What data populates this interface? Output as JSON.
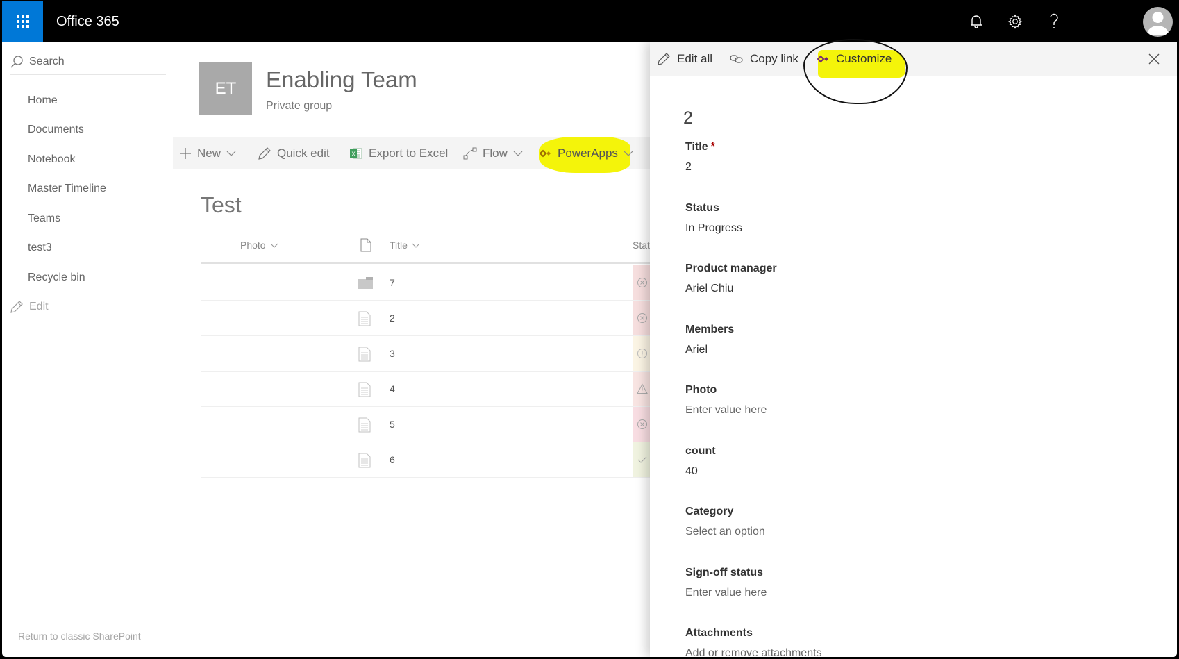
{
  "suitebar": {
    "brand": "Office 365",
    "icons": [
      "waffle-icon",
      "bell-icon",
      "gear-icon",
      "help-icon",
      "avatar-icon"
    ],
    "accent": "#0078d7"
  },
  "leftnav": {
    "search_placeholder": "Search",
    "items": [
      {
        "label": "Home"
      },
      {
        "label": "Documents"
      },
      {
        "label": "Notebook"
      },
      {
        "label": "Master Timeline"
      },
      {
        "label": "Teams"
      },
      {
        "label": "test3"
      },
      {
        "label": "Recycle bin"
      }
    ],
    "edit_label": "Edit",
    "classic_link": "Return to classic SharePoint"
  },
  "site": {
    "logo_initials": "ET",
    "title": "Enabling Team",
    "subtitle": "Private group"
  },
  "commandbar": {
    "new": "New",
    "quick_edit": "Quick edit",
    "export": "Export to Excel",
    "flow": "Flow",
    "powerapps": "PowerApps"
  },
  "list": {
    "title": "Test",
    "columns": {
      "photo": "Photo",
      "title": "Title",
      "status": "Stat"
    },
    "rows": [
      {
        "type": "folder",
        "title": "7",
        "status": "blocked",
        "status_color": "#f6dede"
      },
      {
        "type": "item",
        "title": "2",
        "status": "blocked",
        "status_color": "#f6dede"
      },
      {
        "type": "item",
        "title": "3",
        "status": "info",
        "status_color": "#fbf4e4"
      },
      {
        "type": "item",
        "title": "4",
        "status": "warning",
        "status_color": "#f8e4e2"
      },
      {
        "type": "item",
        "title": "5",
        "status": "blocked",
        "status_color": "#f8dde2"
      },
      {
        "type": "item",
        "title": "6",
        "status": "done",
        "status_color": "#f0f3e0"
      }
    ]
  },
  "panel": {
    "edit_all": "Edit all",
    "copy_link": "Copy link",
    "customize": "Customize",
    "item_header": "2",
    "fields": [
      {
        "label": "Title",
        "required": true,
        "value": "2",
        "placeholder": false
      },
      {
        "label": "Status",
        "required": false,
        "value": "In Progress",
        "placeholder": false
      },
      {
        "label": "Product manager",
        "required": false,
        "value": "Ariel Chiu",
        "placeholder": false
      },
      {
        "label": "Members",
        "required": false,
        "value": "Ariel",
        "placeholder": false
      },
      {
        "label": "Photo",
        "required": false,
        "value": "Enter value here",
        "placeholder": true
      },
      {
        "label": "count",
        "required": false,
        "value": "40",
        "placeholder": false
      },
      {
        "label": "Category",
        "required": false,
        "value": "Select an option",
        "placeholder": true
      },
      {
        "label": "Sign-off status",
        "required": false,
        "value": "Enter value here",
        "placeholder": true
      },
      {
        "label": "Attachments",
        "required": false,
        "value": "Add or remove attachments",
        "placeholder": true
      }
    ],
    "required_marker": "*",
    "highlight_color": "#f4f40a"
  }
}
